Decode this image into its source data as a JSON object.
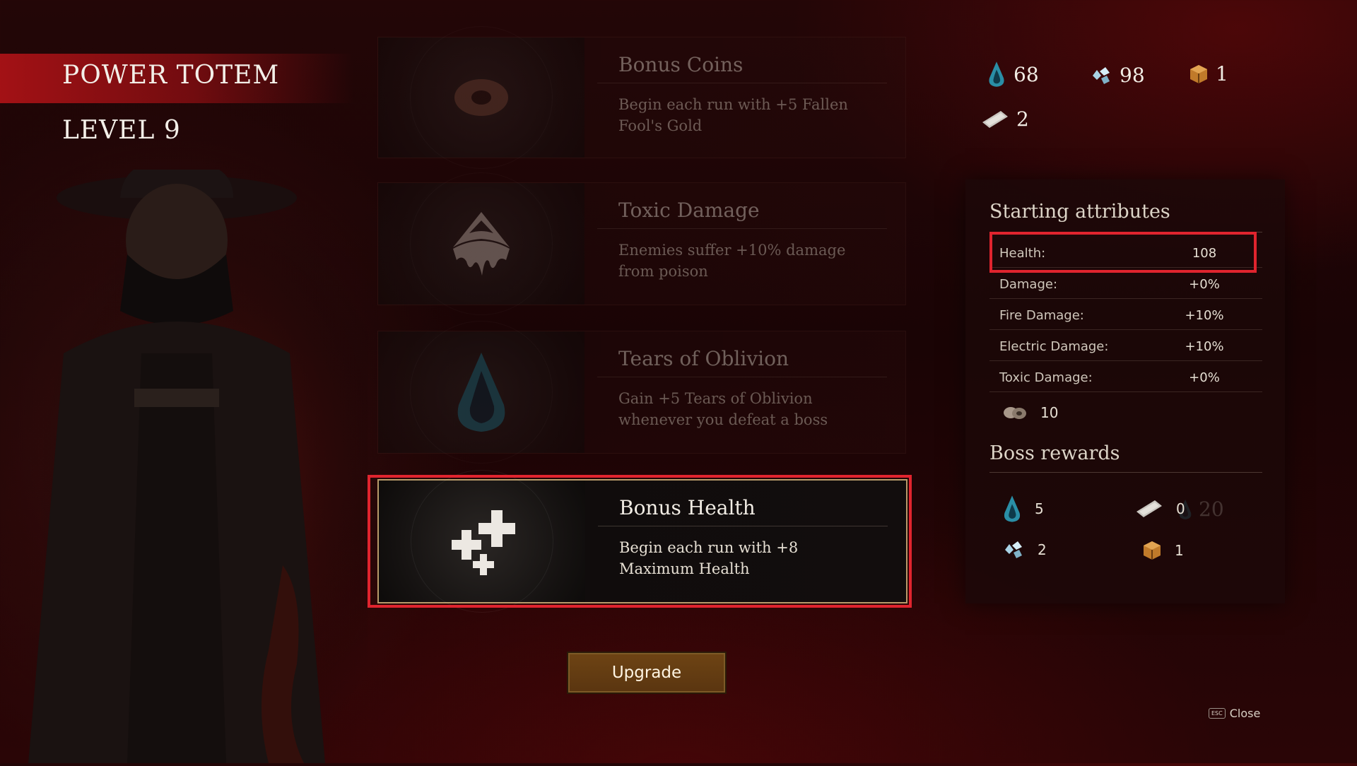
{
  "header": {
    "title": "POWER TOTEM",
    "level": "LEVEL 9"
  },
  "currencies": [
    {
      "icon": "tear-drop-icon",
      "value": "68"
    },
    {
      "icon": "crystal-shards-icon",
      "value": "98"
    },
    {
      "icon": "crate-icon",
      "value": "1"
    },
    {
      "icon": "scroll-icon",
      "value": "2"
    }
  ],
  "cards": [
    {
      "title": "Bonus Coins",
      "desc": "Begin each run with +5 Fallen Fool's Gold"
    },
    {
      "title": "Toxic Damage",
      "desc": "Enemies suffer +10% damage from poison"
    },
    {
      "title": "Tears of Oblivion",
      "desc": "Gain +5 Tears of Oblivion whenever you defeat a boss"
    },
    {
      "title": "Bonus Health",
      "desc": "Begin each run with +8 Maximum Health",
      "cost": "20"
    }
  ],
  "upgrade_label": "Upgrade",
  "starting_attributes": {
    "heading": "Starting attributes",
    "rows": [
      {
        "label": "Health:",
        "value": "108"
      },
      {
        "label": "Damage:",
        "value": "+0%"
      },
      {
        "label": "Fire Damage:",
        "value": "+10%"
      },
      {
        "label": "Electric Damage:",
        "value": "+10%"
      },
      {
        "label": "Toxic Damage:",
        "value": "+0%"
      }
    ],
    "coins": "10"
  },
  "boss_rewards": {
    "heading": "Boss rewards",
    "items": [
      {
        "icon": "tear-drop-icon",
        "value": "5"
      },
      {
        "icon": "scroll-icon",
        "value": "0"
      },
      {
        "icon": "crystal-shards-icon",
        "value": "2"
      },
      {
        "icon": "crate-icon",
        "value": "1"
      }
    ]
  },
  "close": {
    "key": "ESC",
    "label": "Close"
  },
  "colors": {
    "highlight": "#e0242e",
    "accent": "#b89b6a",
    "button": "#6e4414"
  }
}
